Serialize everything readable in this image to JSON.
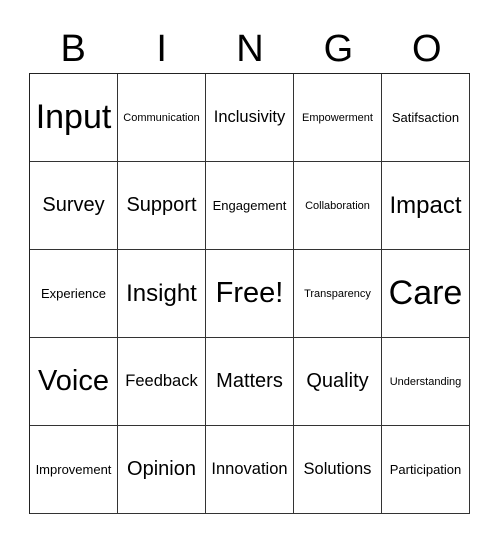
{
  "header": [
    "B",
    "I",
    "N",
    "G",
    "O"
  ],
  "cells": [
    {
      "text": "Input",
      "size": "s33"
    },
    {
      "text": "Communication",
      "size": "s11"
    },
    {
      "text": "Inclusivity",
      "size": "s16"
    },
    {
      "text": "Empowerment",
      "size": "s11"
    },
    {
      "text": "Satifsaction",
      "size": "s13x"
    },
    {
      "text": "Survey",
      "size": "s20"
    },
    {
      "text": "Support",
      "size": "s20"
    },
    {
      "text": "Engagement",
      "size": "s13"
    },
    {
      "text": "Collaboration",
      "size": "s11"
    },
    {
      "text": "Impact",
      "size": "s24"
    },
    {
      "text": "Experience",
      "size": "s13"
    },
    {
      "text": "Insight",
      "size": "s24"
    },
    {
      "text": "Free!",
      "size": "s28"
    },
    {
      "text": "Transparency",
      "size": "s11"
    },
    {
      "text": "Care",
      "size": "s33"
    },
    {
      "text": "Voice",
      "size": "s28"
    },
    {
      "text": "Feedback",
      "size": "s16"
    },
    {
      "text": "Matters",
      "size": "s20"
    },
    {
      "text": "Quality",
      "size": "s20"
    },
    {
      "text": "Understanding",
      "size": "s11"
    },
    {
      "text": "Improvement",
      "size": "s13"
    },
    {
      "text": "Opinion",
      "size": "s20"
    },
    {
      "text": "Innovation",
      "size": "s16"
    },
    {
      "text": "Solutions",
      "size": "s16"
    },
    {
      "text": "Participation",
      "size": "s13"
    }
  ]
}
